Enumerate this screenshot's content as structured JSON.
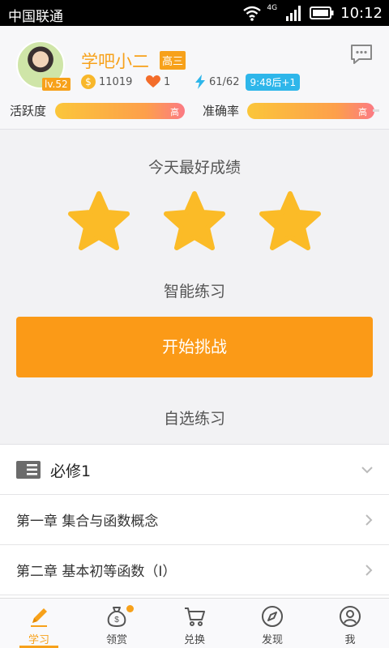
{
  "status_bar": {
    "carrier": "中国联通",
    "network": "4G",
    "time": "10:12"
  },
  "profile": {
    "username": "学吧小二",
    "grade": "高三",
    "level": "lv.52",
    "coins": "11019",
    "hearts": "1",
    "energy": "61/62",
    "energy_timer": "9:48后+1",
    "activity_label": "活跃度",
    "accuracy_label": "准确率",
    "activity_level": "高",
    "accuracy_level": "高",
    "activity_fraction": 0.85,
    "accuracy_fraction": 0.85
  },
  "main": {
    "best_score_title": "今天最好成绩",
    "stars_earned": 3,
    "stars_total": 3,
    "smart_practice_title": "智能练习",
    "start_button": "开始挑战",
    "custom_practice_title": "自选练习"
  },
  "course": {
    "name": "必修1",
    "chapters": [
      {
        "label": "第一章 集合与函数概念"
      },
      {
        "label": "第二章 基本初等函数（Ⅰ）"
      }
    ]
  },
  "tabs": [
    {
      "label": "学习",
      "icon": "pencil-icon",
      "active": true
    },
    {
      "label": "领赏",
      "icon": "money-bag-icon"
    },
    {
      "label": "兑换",
      "icon": "cart-icon"
    },
    {
      "label": "发现",
      "icon": "compass-icon"
    },
    {
      "label": "我",
      "icon": "person-icon"
    }
  ],
  "colors": {
    "accent": "#f7a11a",
    "star": "#fbbb27",
    "energy": "#2eb6ea",
    "button": "#fb9a17"
  }
}
